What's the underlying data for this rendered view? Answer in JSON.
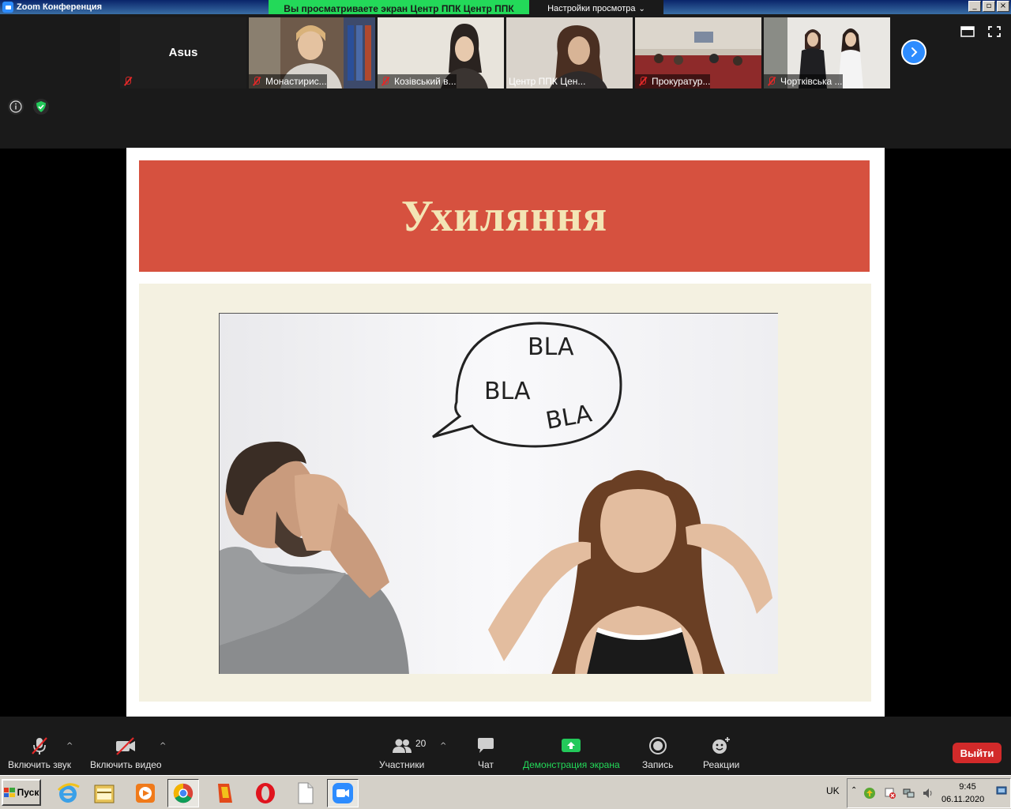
{
  "window": {
    "title": "Zoom Конференция",
    "share_banner": "Вы просматриваете экран Центр ППК Центр ППК",
    "view_options": "Настройки просмотра",
    "view_options_icon": "chevron-down-icon"
  },
  "participants_strip": {
    "tiles": [
      {
        "name": "Asus",
        "muted": true,
        "video": false
      },
      {
        "name": "Монастирис...",
        "muted": true,
        "video": true
      },
      {
        "name": "Козівський в...",
        "muted": true,
        "video": true
      },
      {
        "name": "Центр ППК Цен...",
        "muted": false,
        "video": true
      },
      {
        "name": "Прокуратур...",
        "muted": true,
        "video": true,
        "active_speaker": true
      },
      {
        "name": "Чортківська ...",
        "muted": true,
        "video": true
      }
    ],
    "next_icon": "chevron-right-icon"
  },
  "slide": {
    "title": "Ухиляння",
    "speech_bubble": [
      "BLA",
      "BLA",
      "BLA"
    ]
  },
  "toolbar": {
    "audio": "Включить звук",
    "video": "Включить видео",
    "participants": "Участники",
    "participants_count": "20",
    "chat": "Чат",
    "share_screen": "Демонстрация экрана",
    "record": "Запись",
    "reactions": "Реакции",
    "leave": "Выйти"
  },
  "colors": {
    "accent": "#2d8cff",
    "share_green": "#23d959",
    "leave_red": "#d22a2a",
    "slide_header": "#d6513f",
    "slide_title": "#f3e5b5",
    "slide_body": "#f4f1e1"
  },
  "taskbar": {
    "start": "Пуск",
    "language": "UK",
    "time": "9:45",
    "date": "06.11.2020",
    "apps": [
      "internet-explorer-icon",
      "file-manager-icon",
      "media-player-icon",
      "chrome-icon",
      "document-viewer-icon",
      "opera-icon",
      "blank-document-icon",
      "zoom-icon"
    ]
  }
}
